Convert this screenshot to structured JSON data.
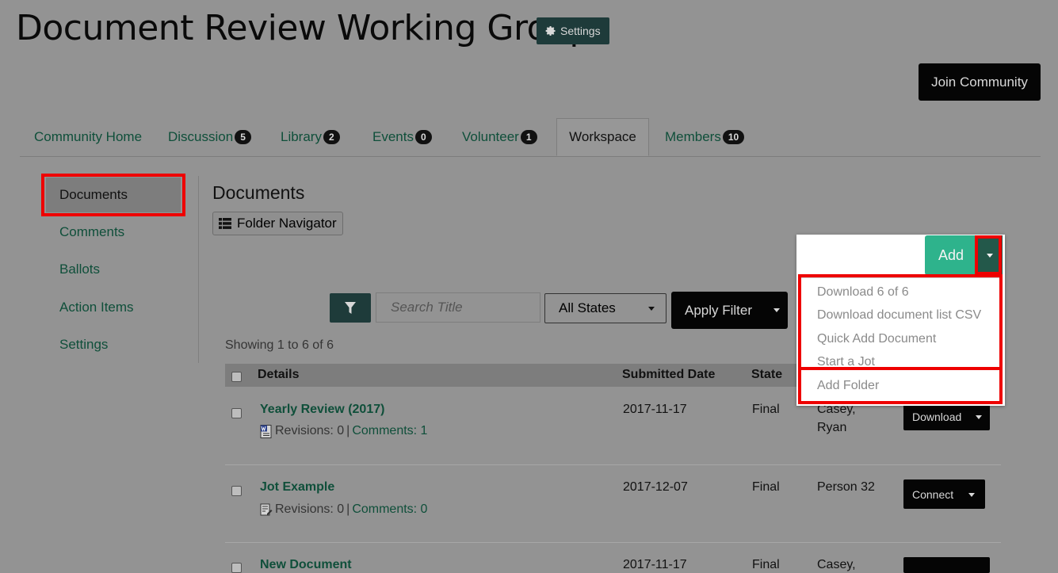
{
  "page": {
    "title": "Document Review Working Group",
    "settings_label": "Settings",
    "join_label": "Join Community"
  },
  "tabs": [
    {
      "label": "Community Home",
      "badge": null
    },
    {
      "label": "Discussion",
      "badge": "5"
    },
    {
      "label": "Library",
      "badge": "2"
    },
    {
      "label": "Events",
      "badge": "0"
    },
    {
      "label": "Volunteer",
      "badge": "1"
    },
    {
      "label": "Workspace",
      "badge": null
    },
    {
      "label": "Members",
      "badge": "10"
    }
  ],
  "sidebar": {
    "items": [
      "Documents",
      "Comments",
      "Ballots",
      "Action Items",
      "Settings"
    ]
  },
  "main": {
    "section_title": "Documents",
    "folder_nav_label": "Folder Navigator",
    "search_placeholder": "Search Title",
    "states_value": "All States",
    "apply_label": "Apply Filter",
    "showing": "Showing 1 to 6 of 6"
  },
  "table": {
    "headers": [
      "Details",
      "Submitted Date",
      "State"
    ],
    "rows": [
      {
        "title": "Yearly Review (2017)",
        "revisions": "Revisions: 0",
        "sep": "|",
        "comments": "Comments: 1",
        "date": "2017-11-17",
        "state": "Final",
        "author": [
          "Casey,",
          "Ryan"
        ],
        "action": "Download"
      },
      {
        "title": "Jot Example",
        "revisions": "Revisions: 0",
        "sep": "|",
        "comments": "Comments: 0",
        "date": "2017-12-07",
        "state": "Final",
        "author": [
          "Person 32"
        ],
        "action": "Connect"
      },
      {
        "title": "New Document",
        "date": "2017-11-17",
        "state": "Final",
        "author": [
          "Casey,"
        ]
      }
    ]
  },
  "add_menu": {
    "add_label": "Add",
    "items": [
      "Download 6 of 6",
      "Download document list CSV",
      "Quick Add Document",
      "Start a Jot",
      "Add Folder"
    ]
  },
  "colors": {
    "accent_green": "#2eb38c",
    "dark_teal": "#1e3b3a",
    "highlight_red": "#ee0000",
    "link_green": "#0f4f3a"
  }
}
